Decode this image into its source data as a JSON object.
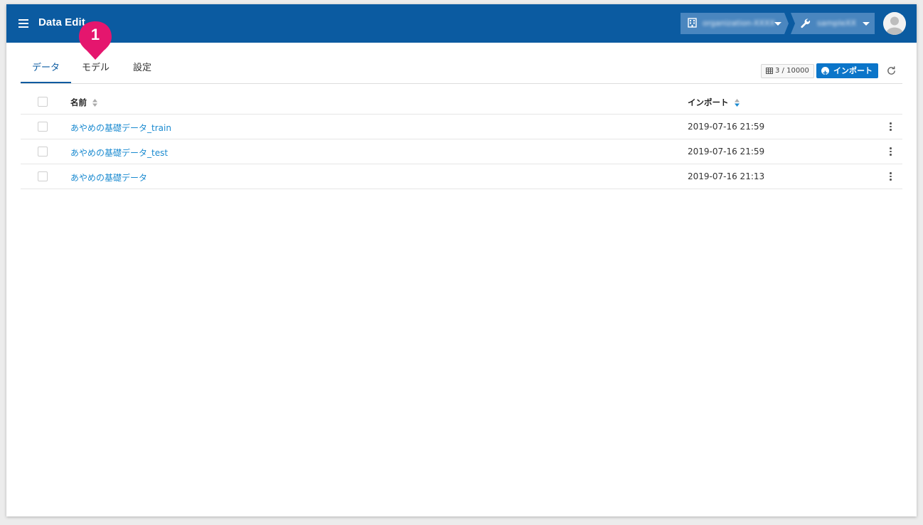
{
  "header": {
    "app_title": "Data Edit",
    "org_label": "organization-XXXX",
    "project_label": "sampleXX"
  },
  "annotation": {
    "badge": "1"
  },
  "tabs": [
    {
      "label": "データ",
      "active": true
    },
    {
      "label": "モデル",
      "active": false
    },
    {
      "label": "設定",
      "active": false
    }
  ],
  "toolbar": {
    "quota": "3 / 10000",
    "import_label": "インポート"
  },
  "table": {
    "headers": {
      "name": "名前",
      "import": "インポート"
    },
    "rows": [
      {
        "name": "あやめの基礎データ_train",
        "date": "2019-07-16 21:59"
      },
      {
        "name": "あやめの基礎データ_test",
        "date": "2019-07-16 21:59"
      },
      {
        "name": "あやめの基礎データ",
        "date": "2019-07-16 21:13"
      }
    ]
  },
  "colors": {
    "header_bg": "#0b5ba1",
    "accent": "#0b75c9",
    "link": "#1a8ad0",
    "badge": "#e5166e"
  }
}
